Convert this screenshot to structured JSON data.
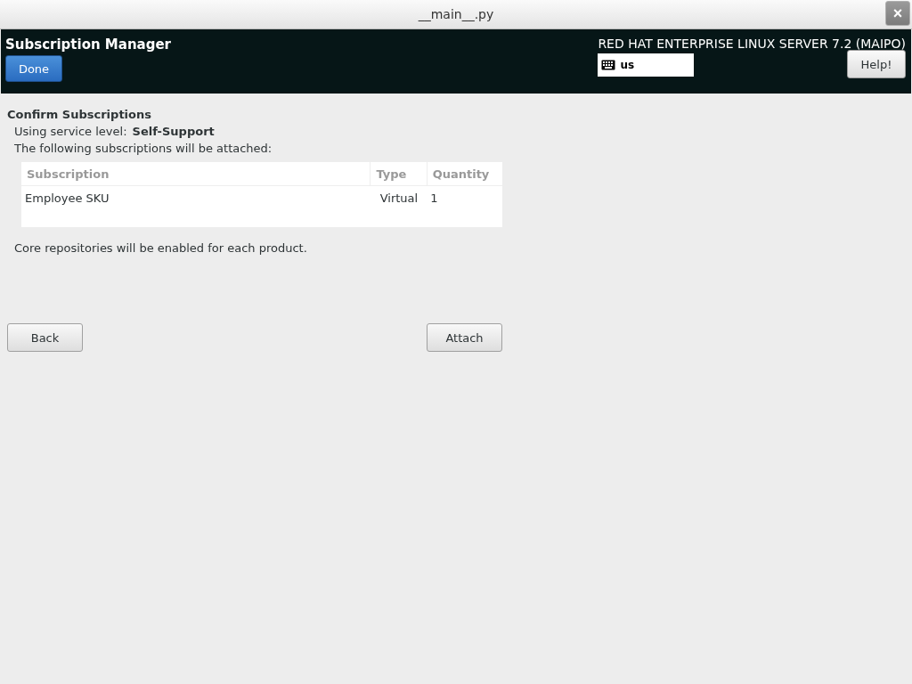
{
  "window": {
    "title": "__main__.py",
    "close": "×"
  },
  "header": {
    "title": "Subscription Manager",
    "done": "Done",
    "product": "RED HAT ENTERPRISE LINUX SERVER 7.2 (MAIPO)",
    "keyboard_layout": "us",
    "help": "Help!"
  },
  "content": {
    "heading": "Confirm Subscriptions",
    "service_level_label": "Using service level:",
    "service_level": "Self-Support",
    "intro": "The following subscriptions will be attached:",
    "table": {
      "columns": [
        "Subscription",
        "Type",
        "Quantity"
      ],
      "rows": [
        [
          "Employee SKU",
          "Virtual",
          "1"
        ]
      ]
    },
    "note": "Core repositories will be enabled for each product."
  },
  "buttons": {
    "back": "Back",
    "attach": "Attach"
  }
}
